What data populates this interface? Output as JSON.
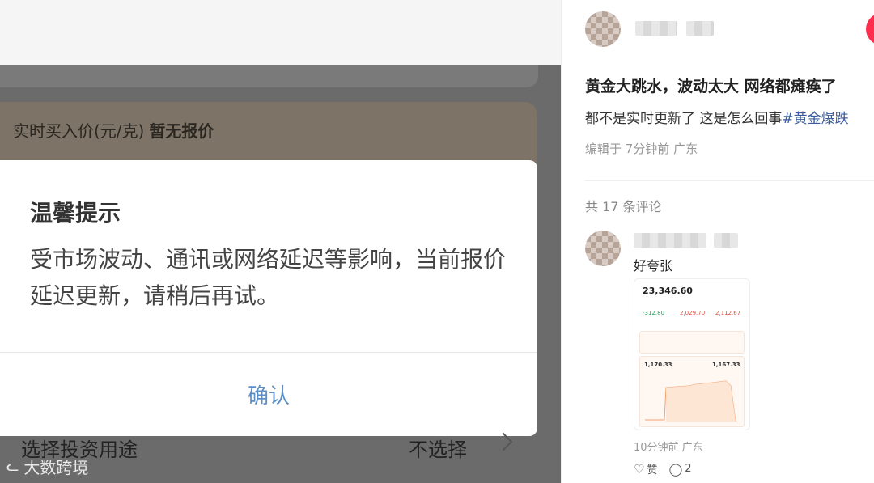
{
  "left": {
    "price_label": "实时买入价(元/克)",
    "price_value": "暂无报价",
    "purpose_label": "选择投资用途",
    "purpose_value": "不选择",
    "watermark": "大数跨境",
    "watermark_icon": "link-icon"
  },
  "dialog": {
    "title": "温馨提示",
    "message": "受市场波动、通讯或网络延迟等影响，当前报价延迟更新，请稍后再试。",
    "confirm_label": "确认"
  },
  "post": {
    "title": "黄金大跳水，波动太大 网络都瘫痪了",
    "body_text": "都不是实时更新了 这是怎么回事",
    "hashtag": "#黄金爆跌",
    "meta": "编辑于 7分钟前 广东",
    "follow_color": "#ff2e4d"
  },
  "comments": {
    "count_label": "共 17 条评论",
    "items": [
      {
        "text": "好夸张",
        "meta": "10分钟前 广东",
        "like_label": "赞",
        "reply_count": "2",
        "screenshot": {
          "price": "23,346.60",
          "changes": [
            "-312.80",
            "2,029.70",
            "2,112.67"
          ],
          "left_value": "1,170.33",
          "right_value": "1,167.33"
        }
      }
    ]
  },
  "colors": {
    "accent_link": "#5b8fc7",
    "hashtag": "#3b5b9e",
    "rise_color": "#e2493b",
    "fall_color": "#1aa35a"
  }
}
